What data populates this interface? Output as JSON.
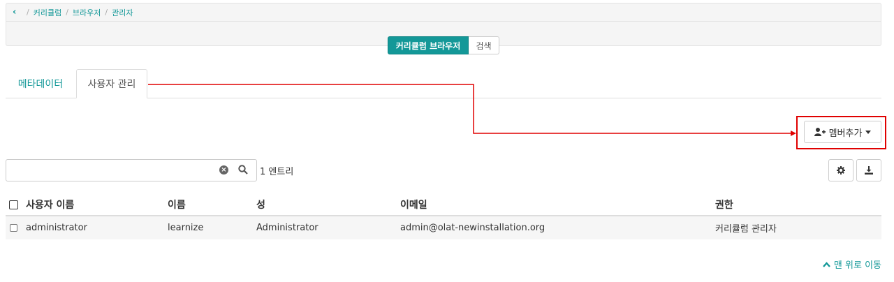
{
  "breadcrumb": {
    "back_glyph": "‹",
    "items": [
      "커리큘럼",
      "브라우저",
      "관리자"
    ],
    "separator": "/"
  },
  "view_switch": {
    "active_label": "커리큘럼 브라우저",
    "other_label": "검색"
  },
  "tabs": [
    {
      "label": "메타데이터",
      "active": false
    },
    {
      "label": "사용자 관리",
      "active": true
    }
  ],
  "toolbar": {
    "add_member_label": "멤버추가",
    "add_member_icon": "user-plus-icon"
  },
  "search": {
    "value": "",
    "placeholder": "",
    "clear_icon": "clear-icon",
    "search_icon": "search-icon",
    "entries_text": "1 엔트리"
  },
  "table": {
    "columns": [
      "사용자 이름",
      "이름",
      "성",
      "이메일",
      "권한"
    ],
    "rows": [
      {
        "username": "administrator",
        "first_name": "learnize",
        "last_name": "Administrator",
        "email": "admin@olat-newinstallation.org",
        "role": "커리큘럼 관리자"
      }
    ]
  },
  "footer": {
    "back_to_top": "맨 위로 이동"
  },
  "colors": {
    "accent": "#139898",
    "highlight": "#e00000"
  }
}
